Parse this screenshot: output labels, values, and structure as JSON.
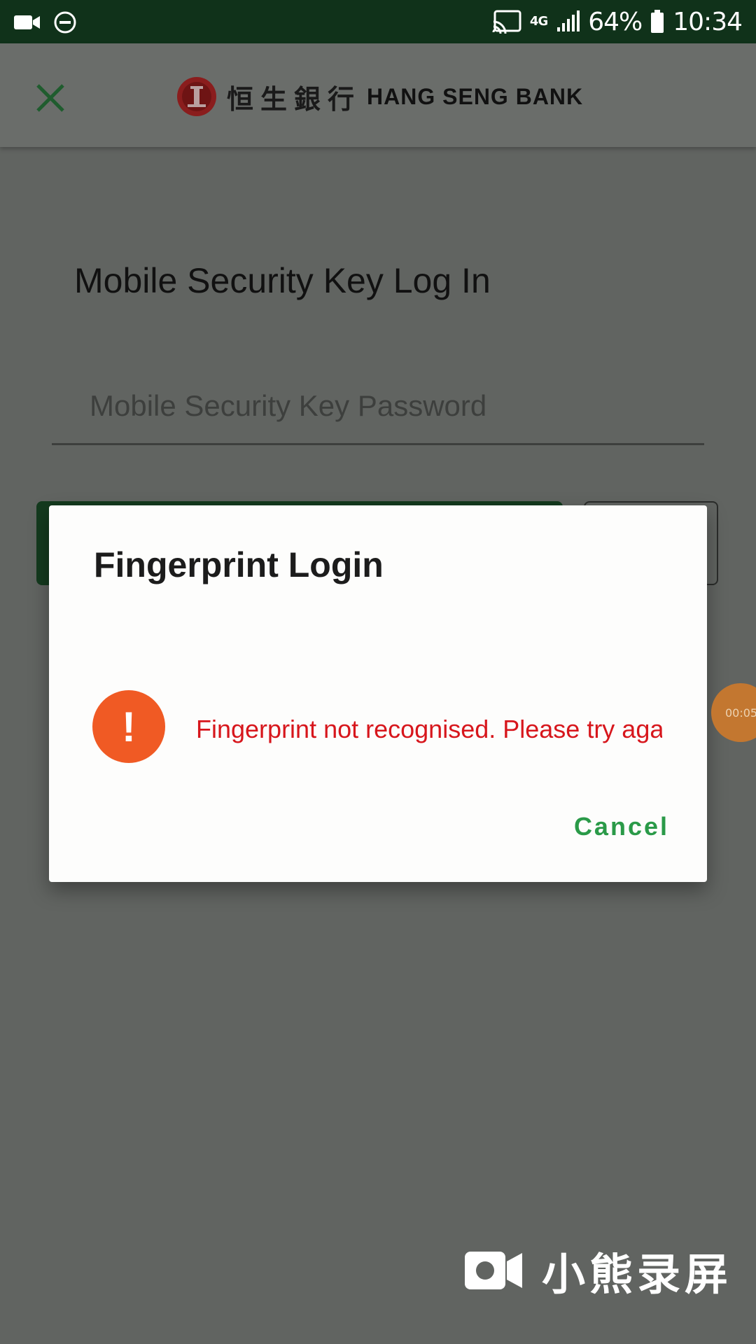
{
  "status_bar": {
    "battery_percent": "64%",
    "time": "10:34",
    "network": "4G",
    "icons": [
      "video-camera-icon",
      "do-not-disturb-icon",
      "cast-icon",
      "signal-icon",
      "battery-icon"
    ]
  },
  "app_bar": {
    "logo_zh": "恒生銀行",
    "logo_en": "HANG SENG BANK",
    "close_icon": "close-icon",
    "brand_color": "#c41e24"
  },
  "page": {
    "title": "Mobile Security Key Log In",
    "password_placeholder": "Mobile Security Key Password"
  },
  "dialog": {
    "title": "Fingerprint Login",
    "error_message": "Fingerprint not recognised. Please try again.",
    "cancel_label": "Cancel",
    "error_icon": "exclamation-icon",
    "error_color": "#d7161c",
    "accent_color": "#2a9a48"
  },
  "recorder": {
    "timer": "00:05",
    "watermark_text": "小熊录屏"
  }
}
